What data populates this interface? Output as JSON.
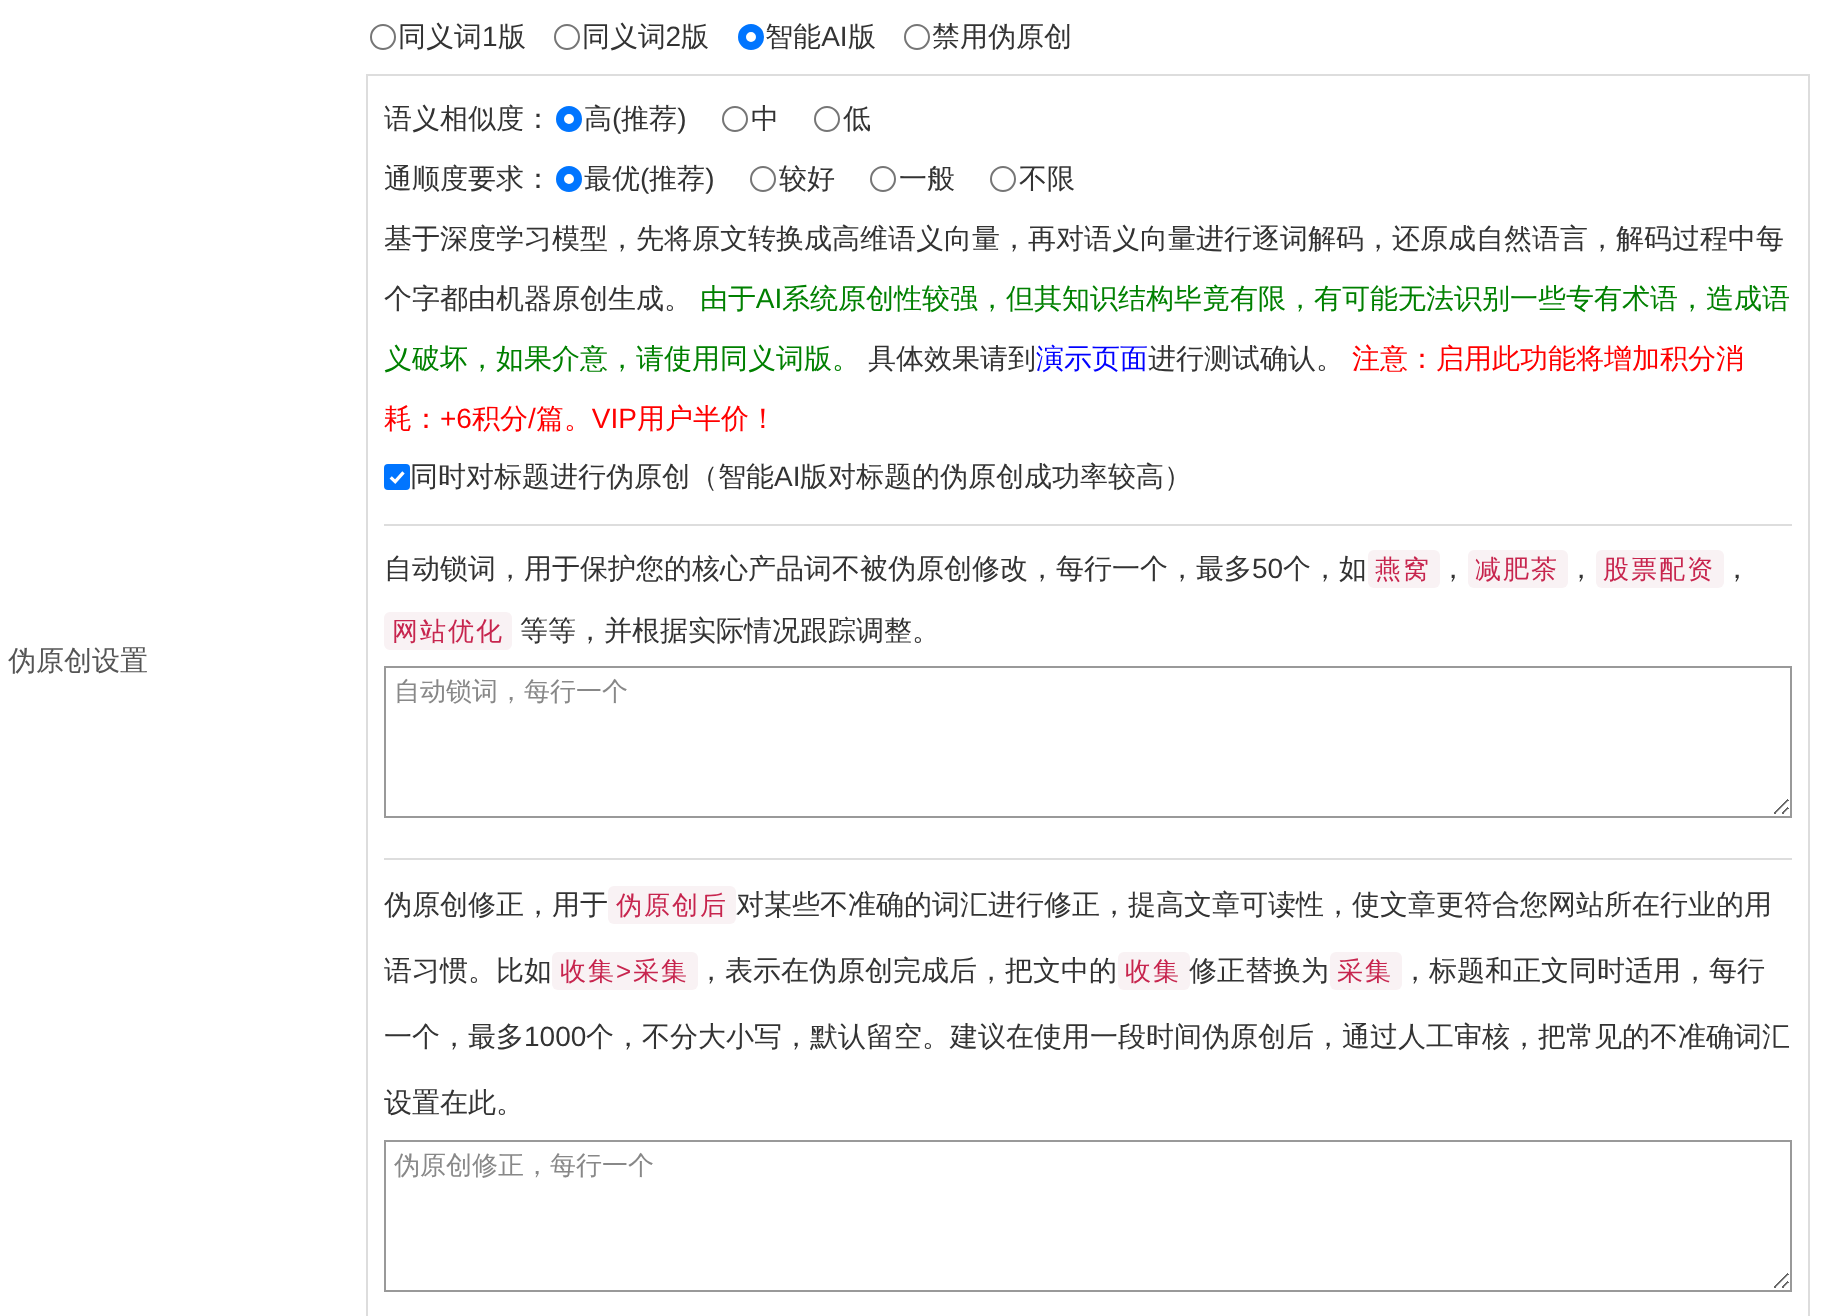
{
  "section_label": "伪原创设置",
  "modes": [
    {
      "label": "同义词1版",
      "selected": false
    },
    {
      "label": "同义词2版",
      "selected": false
    },
    {
      "label": "智能AI版",
      "selected": true
    },
    {
      "label": "禁用伪原创",
      "selected": false
    }
  ],
  "similarity": {
    "label": "语义相似度：",
    "options": [
      {
        "label": "高(推荐)",
        "selected": true
      },
      {
        "label": "中",
        "selected": false
      },
      {
        "label": "低",
        "selected": false
      }
    ]
  },
  "fluency": {
    "label": "通顺度要求：",
    "options": [
      {
        "label": "最优(推荐)",
        "selected": true
      },
      {
        "label": "较好",
        "selected": false
      },
      {
        "label": "一般",
        "selected": false
      },
      {
        "label": "不限",
        "selected": false
      }
    ]
  },
  "description": [
    {
      "kind": "text",
      "text": "基于深度学习模型，先将原文转换成高维语义向量，再对语义向量进行逐词解码，还原成自然语言，解码过程中每个字都由机器原创生成。 "
    },
    {
      "kind": "notice",
      "text": "由于AI系统原创性较强，但其知识结构毕竟有限，有可能无法识别一些专有术语，造成语义破坏，如果介意，请使用同义词版。"
    },
    {
      "kind": "text",
      "text": " 具体效果请到"
    },
    {
      "kind": "link",
      "text": "演示页面"
    },
    {
      "kind": "text",
      "text": "进行测试确认。 "
    },
    {
      "kind": "warning",
      "text": "注意：启用此功能将增加积分消耗：+6积分/篇。VIP用户半价！"
    }
  ],
  "title_option": {
    "label": "同时对标题进行伪原创（智能AI版对标题的伪原创成功率较高）",
    "checked": true
  },
  "lock_words": {
    "text": [
      {
        "kind": "text",
        "text": "自动锁词，用于保护您的核心产品词不被伪原创修改，每行一个，最多50个，如"
      },
      {
        "kind": "code",
        "text": "燕窝"
      },
      {
        "kind": "text",
        "text": "，"
      },
      {
        "kind": "code",
        "text": "减肥茶"
      },
      {
        "kind": "text",
        "text": "，"
      },
      {
        "kind": "code",
        "text": "股票配资"
      },
      {
        "kind": "text",
        "text": "，"
      },
      {
        "kind": "code",
        "text": "网站优化"
      },
      {
        "kind": "text",
        "text": " 等等，并根据实际情况跟踪调整。"
      }
    ],
    "placeholder": "自动锁词，每行一个"
  },
  "correction": {
    "text": [
      {
        "kind": "text",
        "text": "伪原创修正，用于"
      },
      {
        "kind": "code",
        "text": "伪原创后"
      },
      {
        "kind": "text",
        "text": "对某些不准确的词汇进行修正，提高文章可读性，使文章更符合您网站所在行业的用语习惯。比如"
      },
      {
        "kind": "code",
        "text": "收集>采集"
      },
      {
        "kind": "text",
        "text": "，表示在伪原创完成后，把文中的"
      },
      {
        "kind": "code",
        "text": "收集"
      },
      {
        "kind": "text",
        "text": "修正替换为"
      },
      {
        "kind": "code",
        "text": "采集"
      },
      {
        "kind": "text",
        "text": "，标题和正文同时适用，每行一个，最多1000个，不分大小写，默认留空。建议在使用一段时间伪原创后，通过人工审核，把常见的不准确词汇设置在此。"
      }
    ],
    "placeholder": "伪原创修正，每行一个"
  }
}
